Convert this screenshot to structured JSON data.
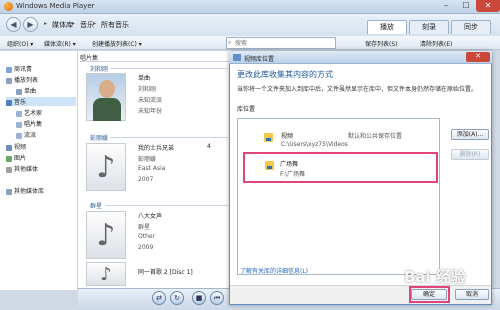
{
  "window": {
    "title": "Windows Media Player",
    "controls": [
      "–",
      "☐",
      "✕"
    ]
  },
  "nav": {
    "breadcrumb": [
      "媒体库",
      "音乐",
      "所有音乐"
    ],
    "tabs": [
      {
        "label": "播放",
        "active": true
      },
      {
        "label": "刻录",
        "active": false
      },
      {
        "label": "同步",
        "active": false
      }
    ]
  },
  "toolbar": {
    "organize": "组织(O) ▾",
    "stream": "媒体流(R) ▾",
    "create_playlist": "创建播放列表(C) ▾",
    "search_placeholder": "搜索",
    "save_list": "保存列表(S)",
    "clear_list": "清除列表(E)"
  },
  "sidebar": {
    "items": [
      {
        "label": "周讯青",
        "indent": 0,
        "selected": false
      },
      {
        "label": "播放列表",
        "indent": 0,
        "selected": false
      },
      {
        "label": "单曲",
        "indent": 1,
        "selected": false
      },
      {
        "label": "音乐",
        "indent": 0,
        "selected": true
      },
      {
        "label": "艺术家",
        "indent": 1,
        "selected": false
      },
      {
        "label": "唱片集",
        "indent": 1,
        "selected": false
      },
      {
        "label": "流派",
        "indent": 1,
        "selected": false
      },
      {
        "label": "视频",
        "indent": 0,
        "selected": false
      },
      {
        "label": "图片",
        "indent": 0,
        "selected": false
      },
      {
        "label": "其他媒体",
        "indent": 0,
        "selected": false
      },
      {
        "label": "其他媒体库",
        "indent": 0,
        "selected": false
      }
    ]
  },
  "content": {
    "column_header": "唱片集",
    "groups": [
      {
        "header": "刘和刚",
        "album": "单曲",
        "artist": "刘和刚",
        "genre": "未知流派",
        "year": "未知年份",
        "track": "",
        "art": "photo"
      },
      {
        "header": "彭丽媛",
        "album": "我的士兵兄弟",
        "artist": "彭丽媛",
        "genre": "East Asia",
        "year": "2007",
        "track": "4",
        "art": "note"
      },
      {
        "header": "群星",
        "album": "八大女声",
        "artist": "群星",
        "genre": "Other",
        "year": "2009",
        "track": "",
        "art": "note"
      },
      {
        "header": "",
        "album": "同一首歌 2 [Disc 1]",
        "artist": "",
        "genre": "",
        "year": "",
        "track": "",
        "art": "note"
      }
    ]
  },
  "dialog": {
    "title": "视频库位置",
    "heading": "更改此库收集其内容的方式",
    "description": "当你将一个文件夹加入到库中后，文件虽然显示在库中，但文件本身仍然存储在原始位置。",
    "library_locations_label": "库位置",
    "folders": [
      {
        "name": "视频",
        "path": "C:\\Users\\xyz75\\Videos",
        "note": "默认和公共保存位置",
        "highlighted": false
      },
      {
        "name": "广场舞",
        "path": "F:\\广场舞",
        "note": "",
        "highlighted": true
      }
    ],
    "add_button": "添加(A)...",
    "remove_button": "删除(R)",
    "learn_more_link": "了解有关库的详细信息(L)",
    "ok_button": "确定",
    "cancel_button": "取消"
  },
  "watermark": "Bai 经验",
  "colors": {
    "accent": "#1d5aa3",
    "highlight_border": "#e0457a"
  }
}
